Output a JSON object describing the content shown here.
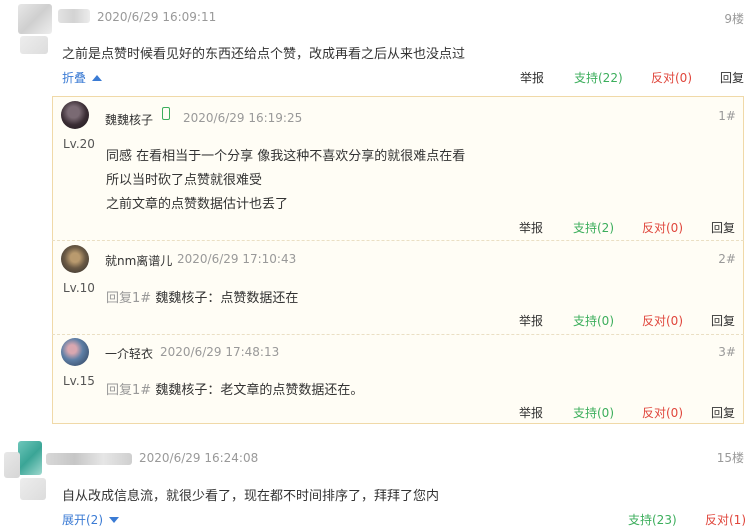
{
  "comments": [
    {
      "time": "2020/6/29 16:09:11",
      "floor": "9楼",
      "text": "之前是点赞时候看见好的东西还给点个赞，改成再看之后从来也没点过",
      "toggle": "折叠",
      "actions": {
        "report": "举报",
        "support": "支持(22)",
        "oppose": "反对(0)",
        "reply": "回复"
      },
      "replies": [
        {
          "user": "魏魏核子",
          "time": "2020/6/29 16:19:25",
          "floor": "1#",
          "level": "Lv.20",
          "lines": [
            "同感 在看相当于一个分享 像我这种不喜欢分享的就很难点在看",
            "所以当时砍了点赞就很难受",
            "之前文章的点赞数据估计也丢了"
          ],
          "actions": {
            "report": "举报",
            "support": "支持(2)",
            "oppose": "反对(0)",
            "reply": "回复"
          }
        },
        {
          "user": "就nm离谱儿",
          "time": "2020/6/29 17:10:43",
          "floor": "2#",
          "level": "Lv.10",
          "reply_prefix": "回复1#",
          "reply_target": "魏魏核子：",
          "reply_text": "点赞数据还在",
          "actions": {
            "report": "举报",
            "support": "支持(0)",
            "oppose": "反对(0)",
            "reply": "回复"
          }
        },
        {
          "user": "一介轻衣",
          "time": "2020/6/29 17:48:13",
          "floor": "3#",
          "level": "Lv.15",
          "reply_prefix": "回复1#",
          "reply_target": "魏魏核子：",
          "reply_text": "老文章的点赞数据还在。",
          "actions": {
            "report": "举报",
            "support": "支持(0)",
            "oppose": "反对(0)",
            "reply": "回复"
          }
        }
      ]
    },
    {
      "time": "2020/6/29 16:24:08",
      "floor": "15楼",
      "text": "自从改成信息流，就很少看了，现在都不时间排序了，拜拜了您内",
      "toggle": "展开(2)",
      "actions": {
        "support": "支持(23)",
        "oppose": "反对(1)"
      }
    }
  ]
}
